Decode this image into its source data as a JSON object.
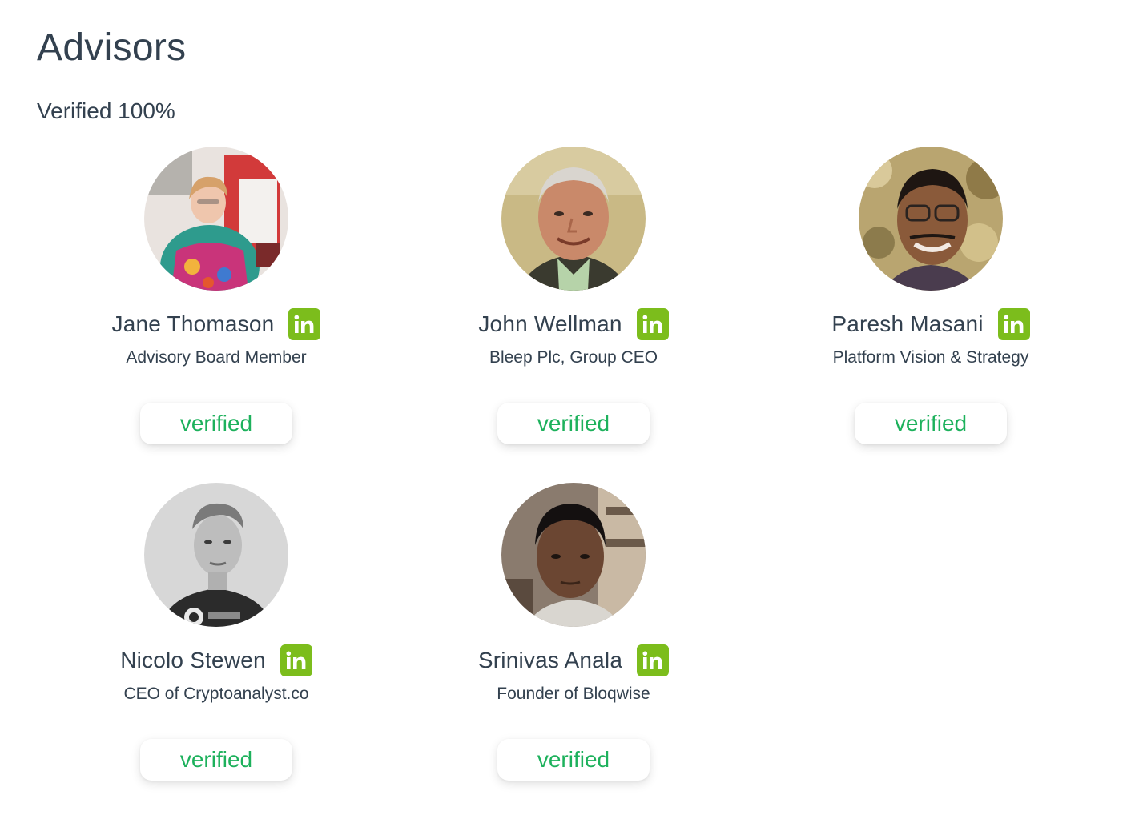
{
  "page": {
    "title": "Advisors",
    "verified_summary": "Verified 100%"
  },
  "advisors": [
    {
      "name": "Jane Thomason",
      "role": "Advisory Board Member",
      "status": "verified",
      "linkedin_icon": "linkedin-icon"
    },
    {
      "name": "John Wellman",
      "role": "Bleep Plc, Group CEO",
      "status": "verified",
      "linkedin_icon": "linkedin-icon"
    },
    {
      "name": "Paresh Masani",
      "role": "Platform Vision & Strategy",
      "status": "verified",
      "linkedin_icon": "linkedin-icon"
    },
    {
      "name": "Nicolo Stewen",
      "role": "CEO of Cryptoanalyst.co",
      "status": "verified",
      "linkedin_icon": "linkedin-icon"
    },
    {
      "name": "Srinivas Anala",
      "role": "Founder of Bloqwise",
      "status": "verified",
      "linkedin_icon": "linkedin-icon"
    }
  ],
  "colors": {
    "text": "#33414f",
    "linkedin_badge": "#7cbd1c",
    "verified_text": "#1db15c"
  }
}
